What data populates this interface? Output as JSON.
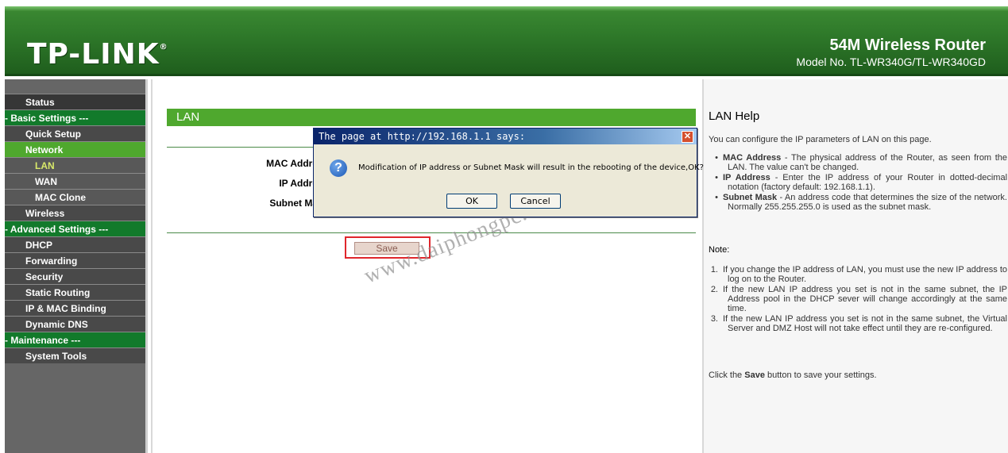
{
  "header": {
    "logo": "TP-LINK",
    "logo_mark": "®",
    "product_title": "54M Wireless Router",
    "model": "Model No. TL-WR340G/TL-WR340GD"
  },
  "sidebar": {
    "items": [
      {
        "label": "Status"
      },
      {
        "label": "- Basic Settings ---"
      },
      {
        "label": "Quick Setup"
      },
      {
        "label": "Network"
      },
      {
        "label": "LAN"
      },
      {
        "label": "WAN"
      },
      {
        "label": "MAC Clone"
      },
      {
        "label": "Wireless"
      },
      {
        "label": "- Advanced Settings ---"
      },
      {
        "label": "DHCP"
      },
      {
        "label": "Forwarding"
      },
      {
        "label": "Security"
      },
      {
        "label": "Static Routing"
      },
      {
        "label": "IP & MAC Binding"
      },
      {
        "label": "Dynamic DNS"
      },
      {
        "label": "- Maintenance ---"
      },
      {
        "label": "System Tools"
      }
    ]
  },
  "main": {
    "title": "LAN",
    "labels": {
      "mac": "MAC Addre",
      "ip": "IP Addre",
      "mask": "Subnet Ma"
    },
    "save_label": "Save"
  },
  "dialog": {
    "title": "The page at http://192.168.1.1 says:",
    "close_glyph": "✕",
    "message": "Modification of IP address or Subnet Mask will result in the rebooting of the device,OK?",
    "ok_label": "OK",
    "cancel_label": "Cancel"
  },
  "watermark": "www.daiphongpc.com",
  "help": {
    "title": "LAN Help",
    "intro": "You can configure the IP parameters of LAN on this page.",
    "items": [
      {
        "term": "MAC Address",
        "text": " - The physical address of the Router, as seen from the LAN. The value can't be changed."
      },
      {
        "term": "IP Address",
        "text": " - Enter the IP address of your Router in dotted-decimal notation (factory default: 192.168.1.1)."
      },
      {
        "term": "Subnet Mask",
        "text": " - An address code that determines the size of the network. Normally 255.255.255.0 is used as the subnet mask."
      }
    ],
    "note_label": "Note",
    "notes": [
      {
        "num": "1.",
        "text": "If you change the IP address of LAN, you must use the new IP address to log on to the Router."
      },
      {
        "num": "2.",
        "text": "If the new LAN IP address you set is not in the same subnet, the IP Address pool in the DHCP sever will change accordingly at the same time."
      },
      {
        "num": "3.",
        "text": "If the new LAN IP address you set is not in the same subnet, the Virtual Server and DMZ Host will not take effect until they are re-configured."
      }
    ],
    "footer_prefix": "Click the ",
    "footer_bold": "Save",
    "footer_suffix": " button to save your settings."
  }
}
